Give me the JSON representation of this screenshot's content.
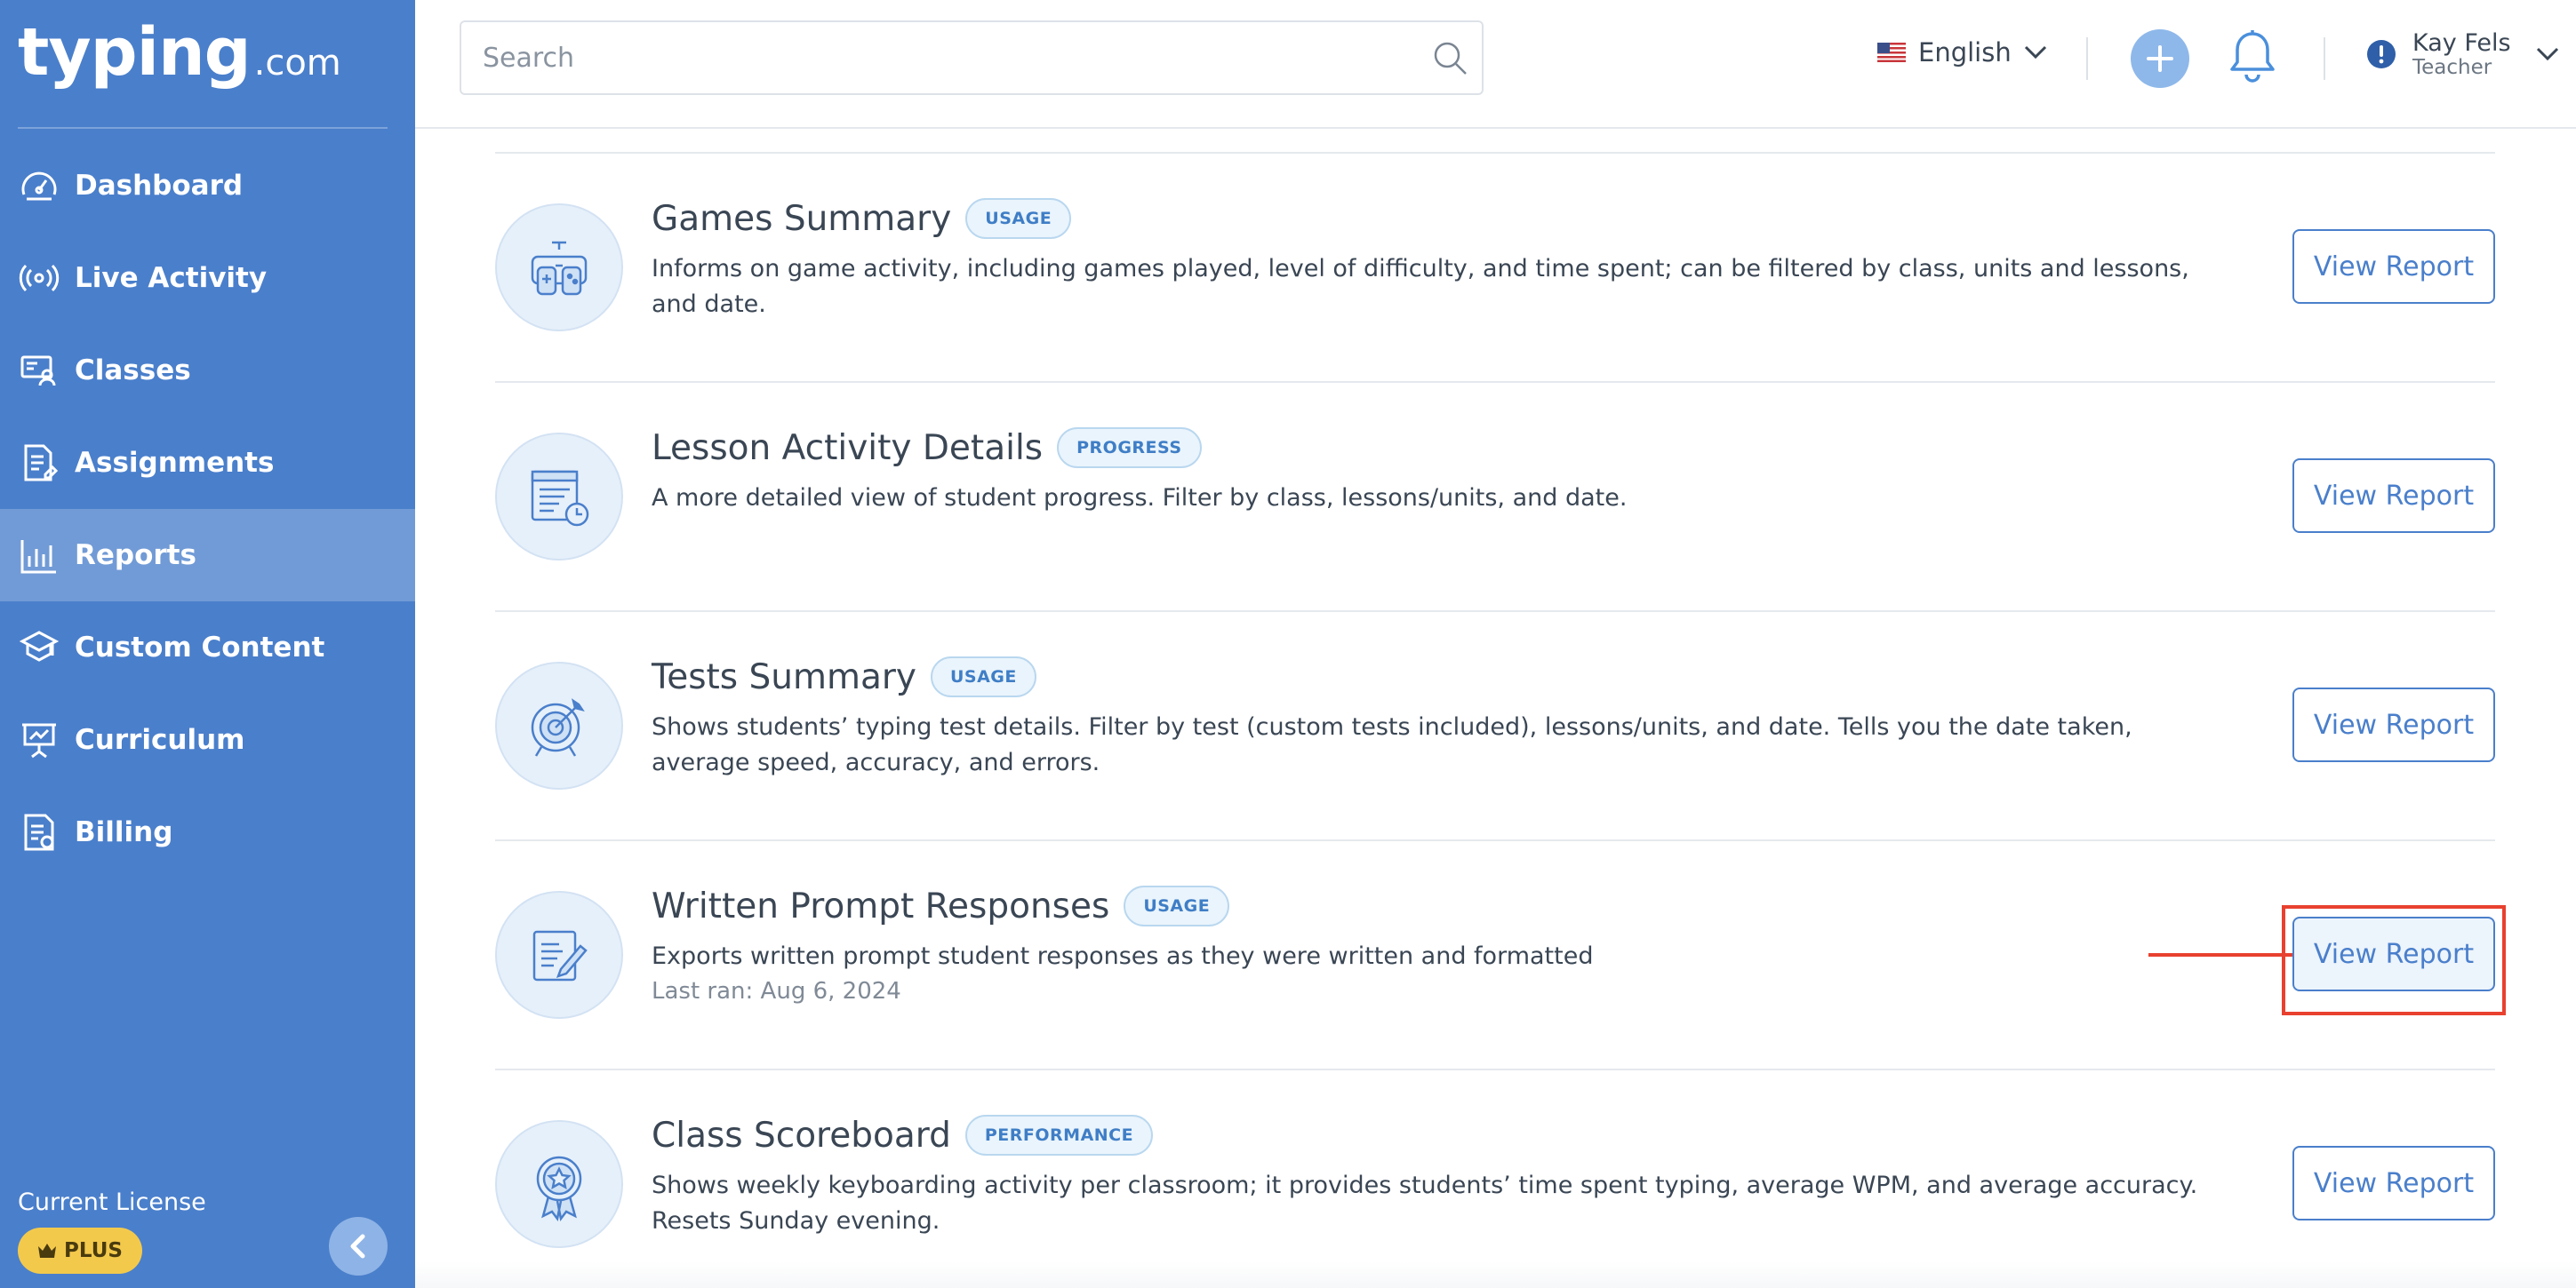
{
  "sidebar": {
    "logo_main": "typing",
    "logo_suffix": ".com",
    "items": [
      {
        "label": "Dashboard",
        "icon": "dashboard-icon"
      },
      {
        "label": "Live Activity",
        "icon": "live-activity-icon"
      },
      {
        "label": "Classes",
        "icon": "classes-icon"
      },
      {
        "label": "Assignments",
        "icon": "assignments-icon"
      },
      {
        "label": "Reports",
        "icon": "reports-icon",
        "active": true
      },
      {
        "label": "Custom Content",
        "icon": "custom-content-icon"
      },
      {
        "label": "Curriculum",
        "icon": "curriculum-icon"
      },
      {
        "label": "Billing",
        "icon": "billing-icon"
      }
    ],
    "license_label": "Current License",
    "license_tier": "PLUS"
  },
  "header": {
    "search_placeholder": "Search",
    "language": "English",
    "user_name": "Kay Fels",
    "user_role": "Teacher"
  },
  "reports": [
    {
      "title": "Games Summary",
      "badge": "USAGE",
      "description": "Informs on game activity, including games played, level of difficulty, and time spent; can be filtered by class, units and lessons, and date.",
      "button": "View Report",
      "icon": "gamepad-icon"
    },
    {
      "title": "Lesson Activity Details",
      "badge": "PROGRESS",
      "description": "A more detailed view of student progress. Filter by class, lessons/units, and date.",
      "button": "View Report",
      "icon": "lesson-clock-icon"
    },
    {
      "title": "Tests Summary",
      "badge": "USAGE",
      "description": "Shows students’ typing test details. Filter by test (custom tests included), lessons/units, and date. Tells you the date taken, average speed, accuracy, and errors.",
      "button": "View Report",
      "icon": "target-icon"
    },
    {
      "title": "Written Prompt Responses",
      "badge": "USAGE",
      "description": "Exports written prompt student responses as they were written and formatted",
      "meta": "Last ran: Aug 6, 2024",
      "button": "View Report",
      "icon": "document-pen-icon",
      "highlighted": true
    },
    {
      "title": "Class Scoreboard",
      "badge": "PERFORMANCE",
      "description": "Shows weekly keyboarding activity per classroom; it provides students’ time spent typing, average WPM, and average accuracy. Resets Sunday evening.",
      "button": "View Report",
      "icon": "award-ribbon-icon"
    }
  ],
  "colors": {
    "sidebar": "#4a7fcb",
    "accent": "#4a7fcb",
    "highlight": "#e8412f",
    "badge_bg": "#eaf4fc",
    "license_badge": "#f3c94c"
  }
}
